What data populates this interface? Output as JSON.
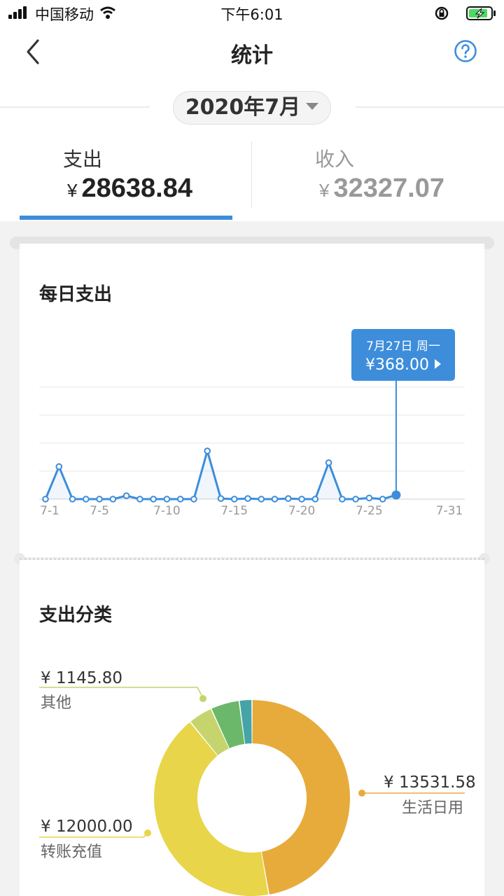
{
  "status_bar": {
    "carrier": "中国移动",
    "time": "下午6:01"
  },
  "header": {
    "title": "统计",
    "back_icon": "chevron-left-icon",
    "help_icon": "question-circle-icon"
  },
  "month_selector": {
    "value": "2020年7月"
  },
  "summary": {
    "expense": {
      "label": "支出",
      "currency": "¥",
      "amount": "28638.84",
      "active": true
    },
    "income": {
      "label": "收入",
      "currency": "¥",
      "amount": "32327.07",
      "active": false
    }
  },
  "colors": {
    "accent": "#3d8ddb",
    "active_text": "#222222",
    "inactive_text": "#999999"
  },
  "daily_card": {
    "title": "每日支出",
    "tooltip": {
      "date": "7月27日 周一",
      "amount": "¥368.00"
    },
    "x_ticks": [
      "7-1",
      "7-5",
      "7-10",
      "7-15",
      "7-20",
      "7-25",
      "7-31"
    ]
  },
  "category_card": {
    "title": "支出分类",
    "labels": {
      "other": {
        "amount": "¥ 1145.80",
        "name": "其他"
      },
      "daily": {
        "amount": "¥ 13531.58",
        "name": "生活日用"
      },
      "transfer": {
        "amount": "¥ 12000.00",
        "name": "转账充值"
      }
    }
  },
  "chart_data": [
    {
      "type": "line",
      "title": "每日支出",
      "x": [
        1,
        2,
        3,
        4,
        5,
        6,
        7,
        8,
        9,
        10,
        11,
        12,
        13,
        14,
        15,
        16,
        17,
        18,
        19,
        20,
        21,
        22,
        23,
        24,
        25,
        26,
        27
      ],
      "x_tick_labels": [
        "7-1",
        "7-5",
        "7-10",
        "7-15",
        "7-20",
        "7-25",
        "7-31"
      ],
      "xlim": [
        1,
        31
      ],
      "series": [
        {
          "values": [
            0,
            2900,
            0,
            0,
            0,
            0,
            300,
            0,
            0,
            0,
            0,
            0,
            4300,
            50,
            0,
            50,
            0,
            0,
            50,
            0,
            0,
            3250,
            0,
            0,
            100,
            0,
            368
          ]
        }
      ],
      "ylim": [
        0,
        10000
      ],
      "grid": true,
      "highlight": {
        "x": 27,
        "value": 368.0
      }
    },
    {
      "type": "pie",
      "title": "支出分类",
      "donut": true,
      "slices": [
        {
          "name": "生活日用",
          "value": 13531.58,
          "color": "#e7ab3c"
        },
        {
          "name": "转账充值",
          "value": 12000.0,
          "color": "#e8d54a"
        },
        {
          "name": "其他",
          "value": 1145.8,
          "color": "#c6d46d"
        },
        {
          "value": 1361.46,
          "color": "#6bb86a"
        },
        {
          "value": 600.0,
          "color": "#46a3a8"
        }
      ]
    }
  ]
}
